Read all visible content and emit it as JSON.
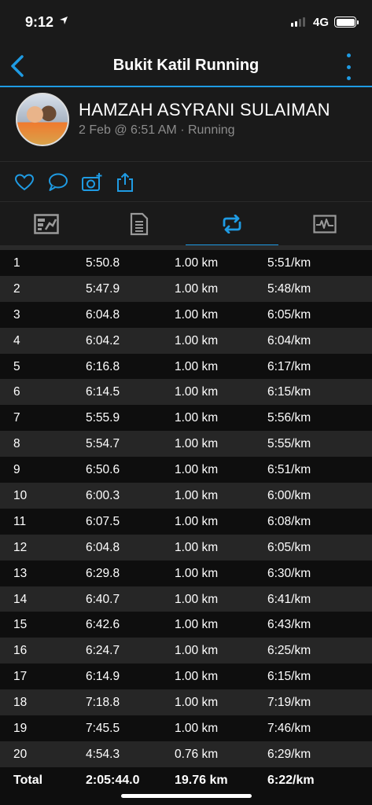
{
  "status_bar": {
    "time": "9:12",
    "network": "4G"
  },
  "nav": {
    "title": "Bukit Katil Running"
  },
  "activity": {
    "user_name": "HAMZAH ASYRANI SULAIMAN",
    "meta": "2 Feb @ 6:51 AM · Running"
  },
  "actions": [
    "heart-icon",
    "comment-icon",
    "camera-add-icon",
    "share-icon"
  ],
  "tabs": [
    {
      "icon": "stats-icon",
      "active": false
    },
    {
      "icon": "details-icon",
      "active": false
    },
    {
      "icon": "laps-icon",
      "active": true
    },
    {
      "icon": "chart-icon",
      "active": false
    }
  ],
  "colors": {
    "accent": "#1f9be3",
    "background": "#1a1a1a"
  },
  "laps": [
    [
      "1",
      "5:50.8",
      "1.00 km",
      "5:51/km"
    ],
    [
      "2",
      "5:47.9",
      "1.00 km",
      "5:48/km"
    ],
    [
      "3",
      "6:04.8",
      "1.00 km",
      "6:05/km"
    ],
    [
      "4",
      "6:04.2",
      "1.00 km",
      "6:04/km"
    ],
    [
      "5",
      "6:16.8",
      "1.00 km",
      "6:17/km"
    ],
    [
      "6",
      "6:14.5",
      "1.00 km",
      "6:15/km"
    ],
    [
      "7",
      "5:55.9",
      "1.00 km",
      "5:56/km"
    ],
    [
      "8",
      "5:54.7",
      "1.00 km",
      "5:55/km"
    ],
    [
      "9",
      "6:50.6",
      "1.00 km",
      "6:51/km"
    ],
    [
      "10",
      "6:00.3",
      "1.00 km",
      "6:00/km"
    ],
    [
      "11",
      "6:07.5",
      "1.00 km",
      "6:08/km"
    ],
    [
      "12",
      "6:04.8",
      "1.00 km",
      "6:05/km"
    ],
    [
      "13",
      "6:29.8",
      "1.00 km",
      "6:30/km"
    ],
    [
      "14",
      "6:40.7",
      "1.00 km",
      "6:41/km"
    ],
    [
      "15",
      "6:42.6",
      "1.00 km",
      "6:43/km"
    ],
    [
      "16",
      "6:24.7",
      "1.00 km",
      "6:25/km"
    ],
    [
      "17",
      "6:14.9",
      "1.00 km",
      "6:15/km"
    ],
    [
      "18",
      "7:18.8",
      "1.00 km",
      "7:19/km"
    ],
    [
      "19",
      "7:45.5",
      "1.00 km",
      "7:46/km"
    ],
    [
      "20",
      "4:54.3",
      "0.76 km",
      "6:29/km"
    ]
  ],
  "total": {
    "label": "Total",
    "time": "2:05:44.0",
    "distance": "19.76 km",
    "pace": "6:22/km"
  }
}
